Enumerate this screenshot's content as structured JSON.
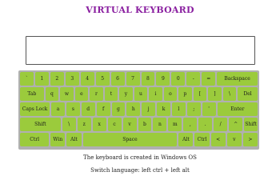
{
  "header": {
    "title": "VIRTUAL KEYBOARD"
  },
  "textarea": {
    "value": ""
  },
  "keyboard": {
    "row1": [
      "`",
      "1",
      "2",
      "3",
      "4",
      "5",
      "6",
      "7",
      "8",
      "9",
      "0",
      "-",
      "=",
      "Backspace"
    ],
    "row2": [
      "Tab",
      "q",
      "w",
      "e",
      "r",
      "t",
      "y",
      "u",
      "i",
      "o",
      "p",
      "[",
      "]",
      "\\",
      "Del"
    ],
    "row3": [
      "Caps Lock",
      "a",
      "s",
      "d",
      "f",
      "g",
      "h",
      "j",
      "k",
      "l",
      ";",
      "'",
      "Enter"
    ],
    "row4": [
      "Shift",
      "\\",
      "z",
      "x",
      "c",
      "v",
      "b",
      "n",
      "m",
      ",",
      ".",
      "/",
      "^",
      "Shift"
    ],
    "row5": [
      "Ctrl",
      "Win",
      "Alt",
      "Space",
      "Alt",
      "Ctrl",
      "<",
      "v",
      ">"
    ]
  },
  "footer": {
    "line1": "The keyboard is created in Windows OS",
    "line2": "Switch language: left ctrl + left alt"
  },
  "colors": {
    "key": "#9bcb3c",
    "title": "#8a1fa0",
    "keyboard_bg": "#b0b0b0"
  }
}
